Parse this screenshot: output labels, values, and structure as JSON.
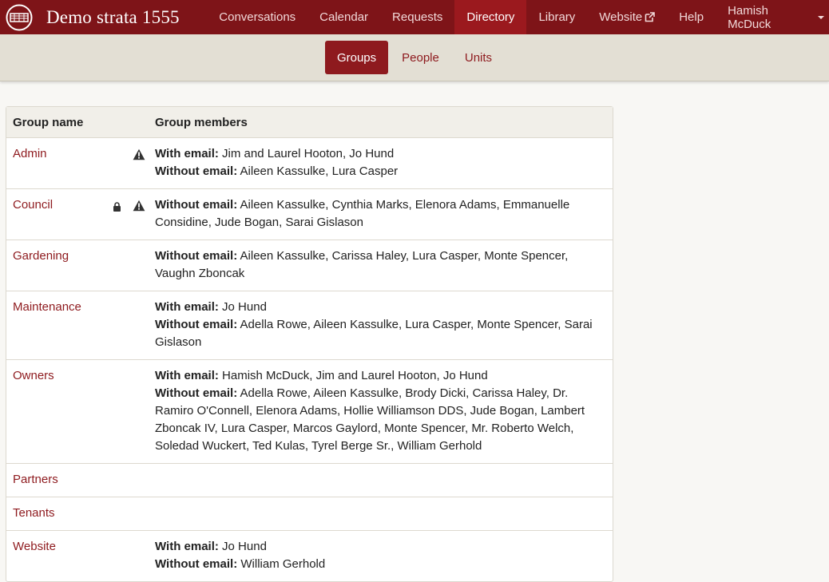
{
  "brand": {
    "name": "Demo strata 1555",
    "logo_icon": "strata-logo-icon"
  },
  "nav": {
    "items": [
      {
        "label": "Conversations",
        "active": false
      },
      {
        "label": "Calendar",
        "active": false
      },
      {
        "label": "Requests",
        "active": false
      },
      {
        "label": "Directory",
        "active": true
      },
      {
        "label": "Library",
        "active": false
      },
      {
        "label": "Website",
        "active": false,
        "icon": "external-link-icon"
      },
      {
        "label": "Help",
        "active": false
      }
    ],
    "user": "Hamish McDuck"
  },
  "subnav": {
    "tabs": [
      {
        "label": "Groups",
        "active": true
      },
      {
        "label": "People",
        "active": false
      },
      {
        "label": "Units",
        "active": false
      }
    ]
  },
  "table": {
    "headers": {
      "name": "Group name",
      "members": "Group members"
    },
    "labels": {
      "with_email": "With email:",
      "without_email": "Without email:"
    },
    "rows": [
      {
        "name": "Admin",
        "locked": false,
        "warning": true,
        "with_email": "Jim and Laurel Hooton, Jo Hund",
        "without_email": "Aileen Kassulke, Lura Casper"
      },
      {
        "name": "Council",
        "locked": true,
        "warning": true,
        "with_email": "",
        "without_email": "Aileen Kassulke, Cynthia Marks, Elenora Adams, Emmanuelle Considine, Jude Bogan, Sarai Gislason"
      },
      {
        "name": "Gardening",
        "locked": false,
        "warning": false,
        "with_email": "",
        "without_email": "Aileen Kassulke, Carissa Haley, Lura Casper, Monte Spencer, Vaughn Zboncak"
      },
      {
        "name": "Maintenance",
        "locked": false,
        "warning": false,
        "with_email": "Jo Hund",
        "without_email": "Adella Rowe, Aileen Kassulke, Lura Casper, Monte Spencer, Sarai Gislason"
      },
      {
        "name": "Owners",
        "locked": false,
        "warning": false,
        "with_email": "Hamish McDuck, Jim and Laurel Hooton, Jo Hund",
        "without_email": "Adella Rowe, Aileen Kassulke, Brody Dicki, Carissa Haley, Dr. Ramiro O'Connell, Elenora Adams, Hollie Williamson DDS, Jude Bogan, Lambert Zboncak IV, Lura Casper, Marcos Gaylord, Monte Spencer, Mr. Roberto Welch, Soledad Wuckert, Ted Kulas, Tyrel Berge Sr., William Gerhold"
      },
      {
        "name": "Partners",
        "locked": false,
        "warning": false,
        "with_email": "",
        "without_email": ""
      },
      {
        "name": "Tenants",
        "locked": false,
        "warning": false,
        "with_email": "",
        "without_email": ""
      },
      {
        "name": "Website",
        "locked": false,
        "warning": false,
        "with_email": "Jo Hund",
        "without_email": "William Gerhold"
      }
    ]
  },
  "colors": {
    "nav_bg": "#7e1418",
    "nav_active": "#9b191e",
    "accent": "#8e1a1e",
    "subnav_bg": "#e3dfd4"
  }
}
